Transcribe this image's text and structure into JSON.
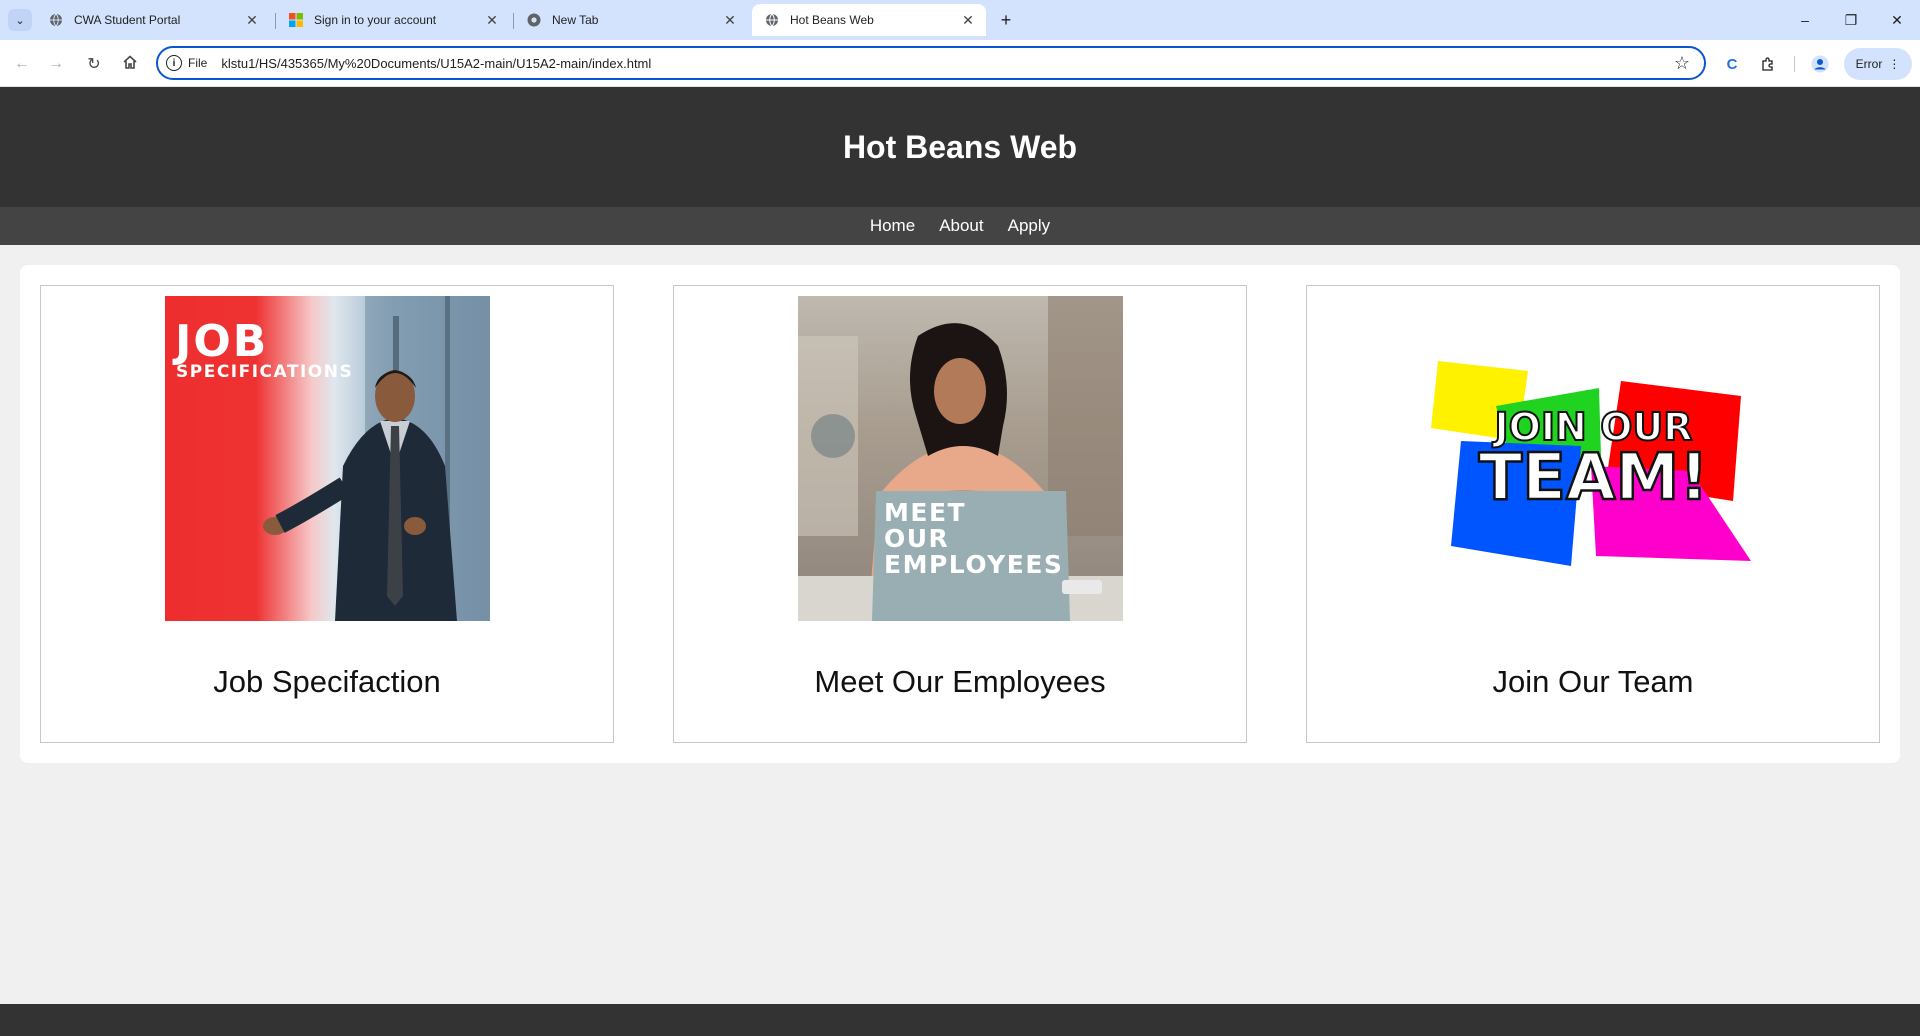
{
  "browser": {
    "tabs": [
      {
        "title": "CWA Student Portal",
        "icon": "globe-icon"
      },
      {
        "title": "Sign in to your account",
        "icon": "microsoft-icon"
      },
      {
        "title": "New Tab",
        "icon": "chrome-icon"
      },
      {
        "title": "Hot Beans Web",
        "icon": "globe-icon",
        "active": true
      }
    ],
    "omnibox": {
      "scheme_label": "File",
      "url": "klstu1/HS/435365/My%20Documents/U15A2-main/U15A2-main/index.html"
    },
    "profile_label": "Error"
  },
  "site": {
    "title": "Hot Beans Web",
    "nav": [
      "Home",
      "About",
      "Apply"
    ],
    "cards": [
      {
        "caption": "Job Specifaction",
        "image_text_line1": "JOB",
        "image_text_line2": "SPECIFICATIONS"
      },
      {
        "caption": "Meet Our Employees",
        "image_text_line1": "MEET",
        "image_text_line2": "OUR",
        "image_text_line3": "EMPLOYEES"
      },
      {
        "caption": "Join Our Team",
        "image_text_line1": "JOIN OUR",
        "image_text_line2": "TEAM!"
      }
    ]
  },
  "colors": {
    "header_bg": "#333333",
    "nav_bg": "#444444",
    "page_bg": "#f0f0f0",
    "accent": "#0b57d0"
  }
}
